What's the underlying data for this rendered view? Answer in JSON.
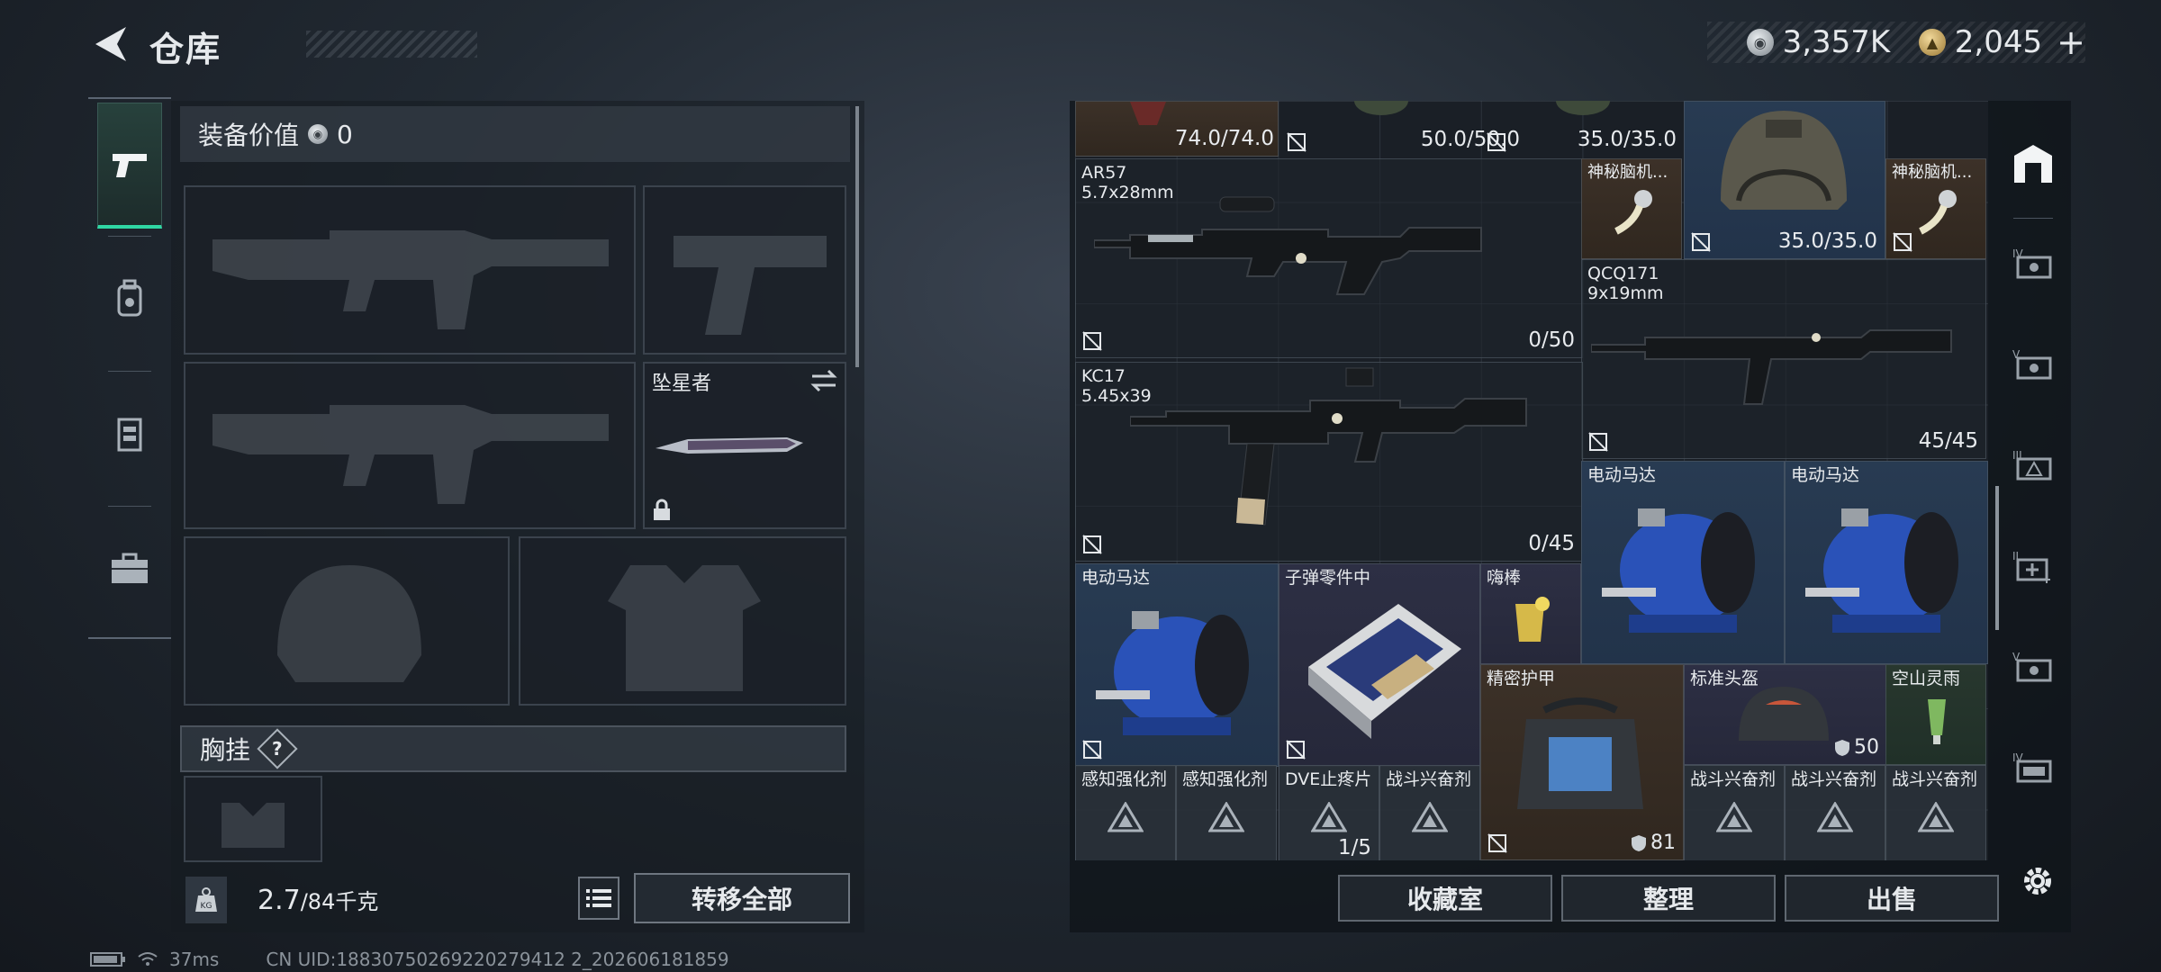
{
  "header": {
    "title": "仓库",
    "currency": {
      "silver_value": "3,357K",
      "gold_value": "2,045",
      "gold_add_label": "+"
    }
  },
  "tabs": [
    {
      "name": "weapons",
      "icon": "pistol-icon",
      "active": true
    },
    {
      "name": "armor",
      "icon": "backpack-icon",
      "active": false
    },
    {
      "name": "rig",
      "icon": "vest-icon",
      "active": false
    },
    {
      "name": "case",
      "icon": "briefcase-icon",
      "active": false
    }
  ],
  "left": {
    "equip_value_label": "装备价值",
    "equip_value": "0",
    "melee_slot_label": "坠星者",
    "chest_label": "胸挂",
    "chest_help": "?",
    "weight_current": "2.7",
    "weight_max": "/84千克",
    "weight_icon_label": "KG",
    "transfer_all_label": "转移全部"
  },
  "stash": {
    "top_row": [
      "74.0/74.0",
      "50.0/50.0",
      "35.0/35.0"
    ],
    "items": {
      "ar57": {
        "name": "AR57",
        "ammo": "5.7x28mm",
        "count": "0/50"
      },
      "mystery1": {
        "name": "神秘脑机..."
      },
      "helmet_top": {
        "durability": "35.0/35.0"
      },
      "mystery2": {
        "name": "神秘脑机..."
      },
      "qcq171": {
        "name": "QCQ171",
        "ammo": "9x19mm",
        "count": "45/45"
      },
      "kc17": {
        "name": "KC17",
        "ammo": "5.45x39",
        "count": "0/45"
      },
      "motor1": {
        "name": "电动马达"
      },
      "motor2": {
        "name": "电动马达"
      },
      "motor3": {
        "name": "电动马达"
      },
      "bullet_parts": {
        "name": "子弹零件中"
      },
      "glowstick": {
        "name": "嗨棒"
      },
      "armor": {
        "name": "精密护甲",
        "durability": "81"
      },
      "std_helmet": {
        "name": "标准头盔",
        "durability": "50"
      },
      "kongshan": {
        "name": "空山灵雨"
      },
      "bottom_row": [
        {
          "name": "感知强化剂"
        },
        {
          "name": "感知强化剂"
        },
        {
          "name": "DVE止疼片",
          "count": "1/5"
        },
        {
          "name": "战斗兴奋剂"
        },
        {
          "name": "战斗兴奋剂"
        },
        {
          "name": "战斗兴奋剂"
        },
        {
          "name": "战斗兴奋剂"
        }
      ]
    }
  },
  "right_toolbar": [
    {
      "icon": "stash-overview-icon"
    },
    {
      "icon": "level-4-container-icon"
    },
    {
      "icon": "level-5-container-icon"
    },
    {
      "icon": "level-3-container-icon"
    },
    {
      "icon": "level-2-add-container-icon"
    },
    {
      "icon": "level-5-container-icon"
    },
    {
      "icon": "level-4-container-icon"
    }
  ],
  "bottom_buttons": {
    "collection": "收藏室",
    "sort": "整理",
    "sell": "出售"
  },
  "status": {
    "ping": "37ms",
    "uid": "CN UID:18830750269220279412 2_202606181859"
  },
  "colors": {
    "accent": "#2fd7a3",
    "rarity_purple": "#2d2f44",
    "rarity_brown": "#3c3128",
    "rarity_blue": "#283b52"
  }
}
